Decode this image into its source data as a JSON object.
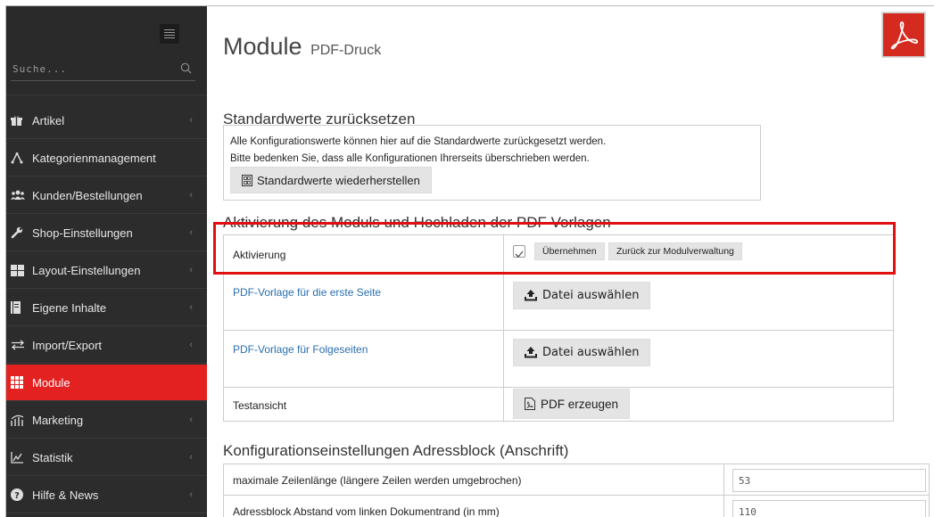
{
  "sidebar": {
    "search_placeholder": "Suche...",
    "items": [
      {
        "label": "Artikel",
        "icon": "gift-icon",
        "chevron": "‹"
      },
      {
        "label": "Kategorienmanagement",
        "icon": "tree-icon",
        "chevron": ""
      },
      {
        "label": "Kunden/Bestellungen",
        "icon": "users-icon",
        "chevron": "‹"
      },
      {
        "label": "Shop-Einstellungen",
        "icon": "wrench-icon",
        "chevron": "‹"
      },
      {
        "label": "Layout-Einstellungen",
        "icon": "grid-icon",
        "chevron": "‹"
      },
      {
        "label": "Eigene Inhalte",
        "icon": "book-icon",
        "chevron": "‹"
      },
      {
        "label": "Import/Export",
        "icon": "arrows-icon",
        "chevron": "‹"
      },
      {
        "label": "Module",
        "icon": "modules-icon",
        "chevron": ""
      },
      {
        "label": "Marketing",
        "icon": "chart-bars-icon",
        "chevron": "‹"
      },
      {
        "label": "Statistik",
        "icon": "line-chart-icon",
        "chevron": "‹"
      },
      {
        "label": "Hilfe & News",
        "icon": "help-icon",
        "chevron": "‹"
      }
    ],
    "active_color": "#e32121"
  },
  "header": {
    "title": "Module",
    "subtitle": "PDF-Druck"
  },
  "reset": {
    "title": "Standardwerte zurücksetzen",
    "line1": "Alle Konfigurationswerte können hier auf die Standardwerte zurückgesetzt werden.",
    "line2": "Bitte bedenken Sie, dass alle Konfigurationen Ihrerseits überschrieben werden.",
    "button": "Standardwerte wiederherstellen"
  },
  "activation": {
    "title": "Aktivierung des Moduls und Hochladen der PDF Vorlagen",
    "label": "Aktivierung",
    "apply_button": "Übernehmen",
    "back_button": "Zurück zur Modulverwaltung",
    "first_page_label": "PDF-Vorlage für die erste Seite",
    "following_pages_label": "PDF-Vorlage für Folgeseiten",
    "file_button": "Datei auswählen",
    "preview_label": "Testansicht",
    "generate_button": "PDF erzeugen"
  },
  "address": {
    "title": "Konfigurationseinstellungen Adressblock (Anschrift)",
    "rows": [
      {
        "label": "maximale Zeilenlänge (längere Zeilen werden umgebrochen)",
        "value": "53"
      },
      {
        "label": "Adressblock Abstand vom linken Dokumentrand (in mm)",
        "value": "110"
      }
    ]
  }
}
